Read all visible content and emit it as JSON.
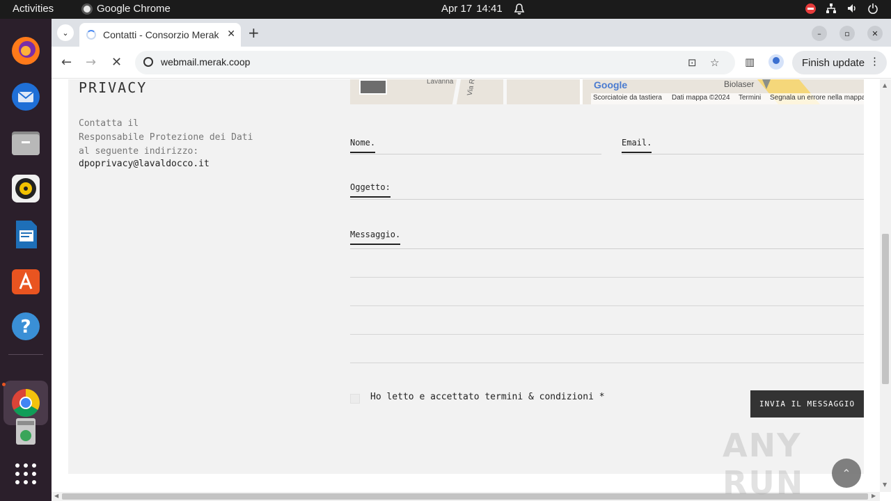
{
  "os": {
    "activities": "Activities",
    "app_name": "Google Chrome",
    "date": "Apr 17",
    "time": "14:41"
  },
  "browser": {
    "tab_title": "Contatti - Consorzio Merak",
    "url": "webmail.merak.coop",
    "finish_update": "Finish update"
  },
  "privacy": {
    "title": "PRIVACY",
    "lines": [
      "Contatta il",
      "Responsabile Protezione dei Dati",
      "al seguente indirizzo:"
    ],
    "email": "dpoprivacy@lavaldocco.it"
  },
  "map": {
    "street1": "Lavanna",
    "street2": "Via R",
    "google": "Google",
    "poi": "Biolaser",
    "shortcuts": "Scorciatoie da tastiera",
    "map_data": "Dati mappa ©2024",
    "terms": "Termini",
    "report": "Segnala un errore nella mappa"
  },
  "form": {
    "name_label": "Nome.",
    "email_label": "Email.",
    "subject_label": "Oggetto:",
    "message_label": "Messaggio.",
    "consent_label": "Ho letto e accettato termini & condizioni *",
    "submit_label": "INVIA IL MESSAGGIO"
  },
  "watermark": "ANY RUN",
  "colors": {
    "panel_bg": "#f2f2f2",
    "button_bg": "#333333",
    "dock_bg": "#2b1f2b",
    "topbar_bg": "#1b1b1b"
  }
}
